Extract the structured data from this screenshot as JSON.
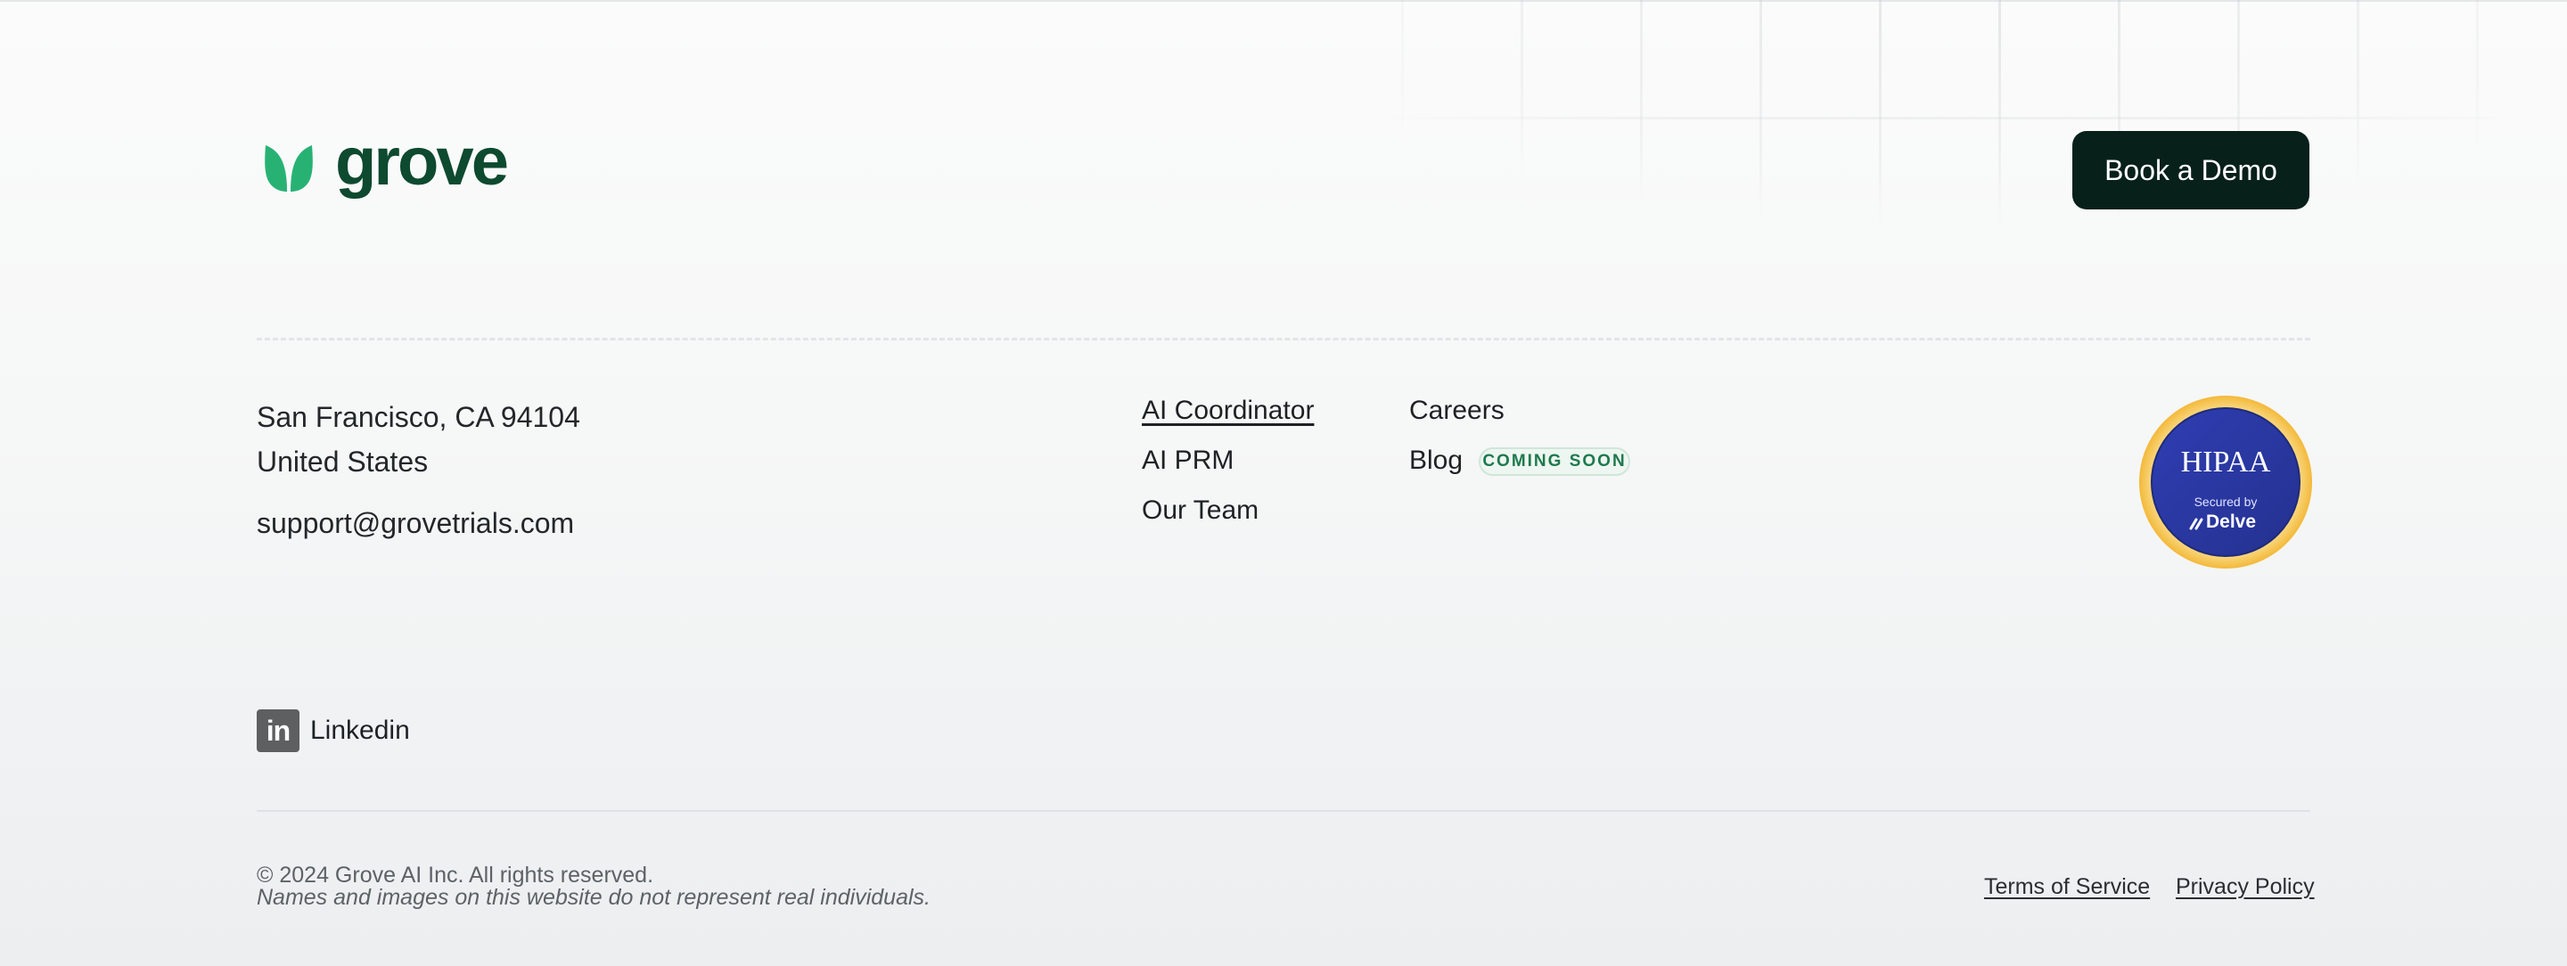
{
  "brand": {
    "name": "grove",
    "logo_color": "#0d4a30",
    "leaf_color": "#27b274"
  },
  "header": {
    "cta_label": "Book a Demo",
    "cta_color": "#07201a"
  },
  "address": {
    "line1": "San Francisco, CA 94104",
    "line2": "United States",
    "email": "support@grovetrials.com"
  },
  "nav": {
    "col1": [
      {
        "label": "AI Coordinator",
        "icon": null
      },
      {
        "label": "AI PRM"
      },
      {
        "label": "Our Team"
      }
    ],
    "col2": [
      {
        "label": "Careers"
      },
      {
        "label": "Blog",
        "badge": "COMING SOON"
      }
    ]
  },
  "compliance_badge": {
    "title": "HIPAA",
    "subtitle": "Secured by",
    "provider": "Delve",
    "icon": "hipaa-seal-icon",
    "ring_color": "#f5c245",
    "fill_color": "#2b3aa8"
  },
  "social": {
    "label": "Linkedin",
    "icon": "linkedin-icon"
  },
  "footer": {
    "copyright": "© 2024 Grove AI Inc. All rights reserved.",
    "disclaimer": "Names and images on this website do not represent real individuals.",
    "terms_label": "Terms of Service",
    "privacy_label": "Privacy Policy"
  }
}
